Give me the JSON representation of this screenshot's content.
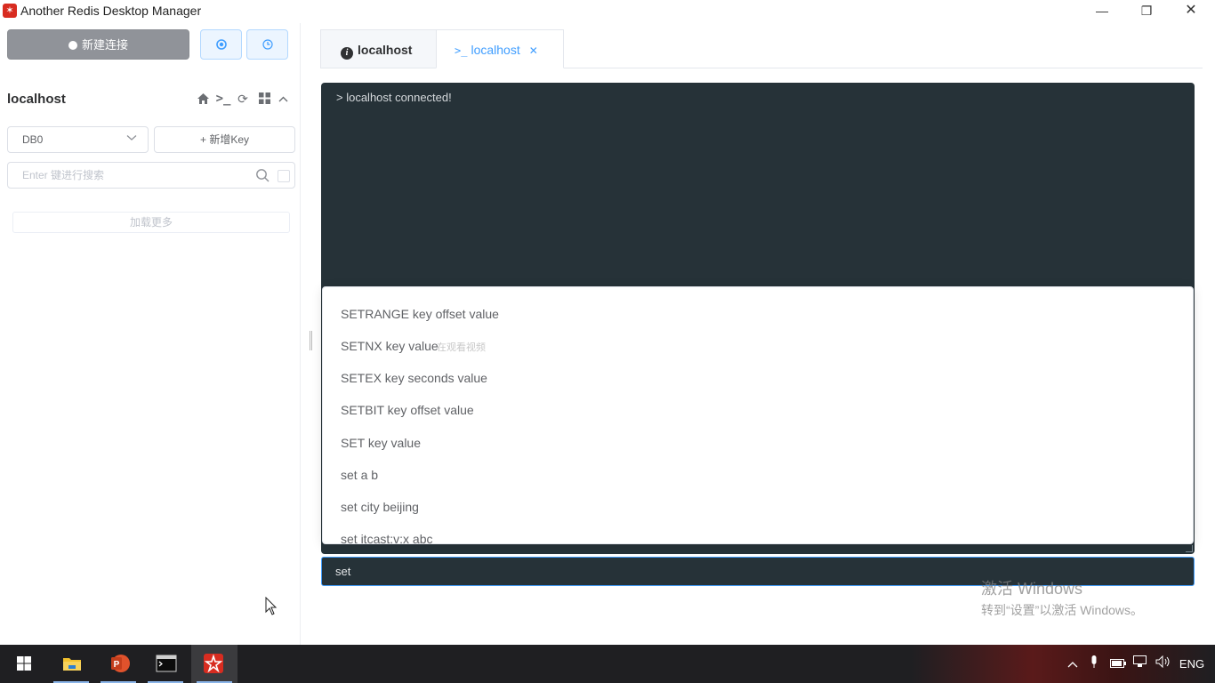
{
  "window": {
    "title": "Another Redis Desktop Manager",
    "app_icon": "redis-desktop-icon"
  },
  "sidebar": {
    "new_connection_label": "新建连接",
    "connection_name": "localhost",
    "db_select_value": "DB0",
    "add_key_label": "+ 新增Key",
    "search_placeholder": "Enter 键进行搜索",
    "load_more_label": "加载更多"
  },
  "tabs": [
    {
      "label": "localhost",
      "icon": "info-icon",
      "active": false
    },
    {
      "label": "localhost",
      "icon": "terminal-icon",
      "active": true
    }
  ],
  "console": {
    "output": "> localhost connected!",
    "input_value": "set",
    "suggestions": [
      "SETRANGE key offset value",
      "SETNX key value",
      "SETEX key seconds value",
      "SETBIT key offset value",
      "SET key value",
      "set a b",
      "set city beijing",
      "set itcast:v:x abc"
    ],
    "ghost_text": "在观看视频"
  },
  "watermark": {
    "title": "激活 Windows",
    "subtitle": "转到“设置”以激活 Windows。"
  },
  "taskbar": {
    "apps": [
      "start-icon",
      "file-explorer-icon",
      "powerpoint-icon",
      "terminal-icon",
      "redis-desktop-icon"
    ],
    "tray_language": "ENG"
  },
  "colors": {
    "accent": "#409eff",
    "console_bg": "#263238",
    "gray_button": "#909399"
  }
}
